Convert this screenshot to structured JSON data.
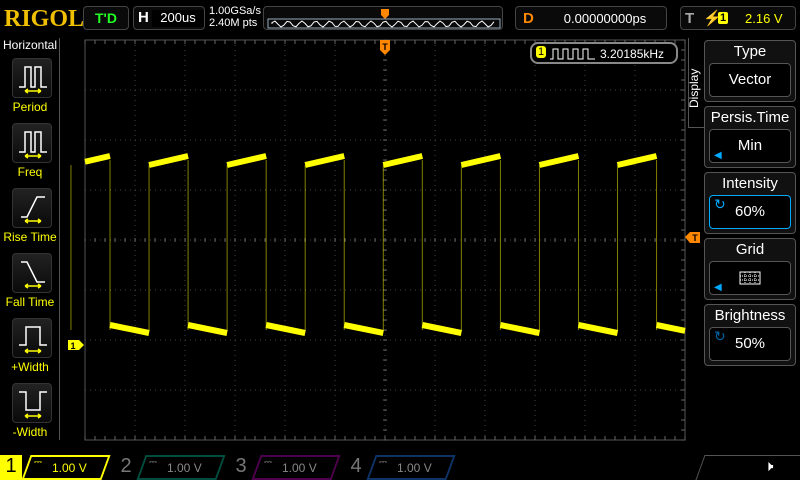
{
  "header": {
    "logo": "RIGOL",
    "run_status": "T'D",
    "h_label": "H",
    "timebase": "200us",
    "sample_rate": "1.00GSa/s",
    "memory_depth": "2.40M pts",
    "d_label": "D",
    "trigger_delay": "0.00000000ps",
    "t_label": "T",
    "trigger_slope": "rising-edge-icon",
    "trigger_source": "1",
    "trigger_level": "2.16 V"
  },
  "left_menu": {
    "title": "Horizontal",
    "items": [
      {
        "label": "Period",
        "icon": "period-icon"
      },
      {
        "label": "Freq",
        "icon": "freq-icon"
      },
      {
        "label": "Rise Time",
        "icon": "rise-time-icon"
      },
      {
        "label": "Fall Time",
        "icon": "fall-time-icon"
      },
      {
        "label": "+Width",
        "icon": "pos-width-icon"
      },
      {
        "label": "-Width",
        "icon": "neg-width-icon"
      }
    ]
  },
  "measurement": {
    "channel": "1",
    "value": "3.20185kHz"
  },
  "markers": {
    "trigger_top": "T",
    "trigger_level": "T",
    "ch1": "1"
  },
  "right_menu": {
    "title": "Display",
    "items": [
      {
        "label": "Type",
        "value": "Vector"
      },
      {
        "label": "Persis.Time",
        "value": "Min"
      },
      {
        "label": "Intensity",
        "value": "60%"
      },
      {
        "label": "Grid",
        "value": "grid-icon"
      },
      {
        "label": "Brightness",
        "value": "50%"
      }
    ]
  },
  "channels": [
    {
      "num": "1",
      "scale": "1.00 V",
      "color": "#ffff00",
      "active": true
    },
    {
      "num": "2",
      "scale": "1.00 V",
      "color": "#00c0a0",
      "active": false
    },
    {
      "num": "3",
      "scale": "1.00 V",
      "color": "#c000c0",
      "active": false
    },
    {
      "num": "4",
      "scale": "1.00 V",
      "color": "#2080ff",
      "active": false
    }
  ],
  "sound_icon": "speaker-mute-icon",
  "waveform": {
    "color": "#ffff00",
    "frequency_khz": 3.20185,
    "timebase_us_per_div": 200
  }
}
